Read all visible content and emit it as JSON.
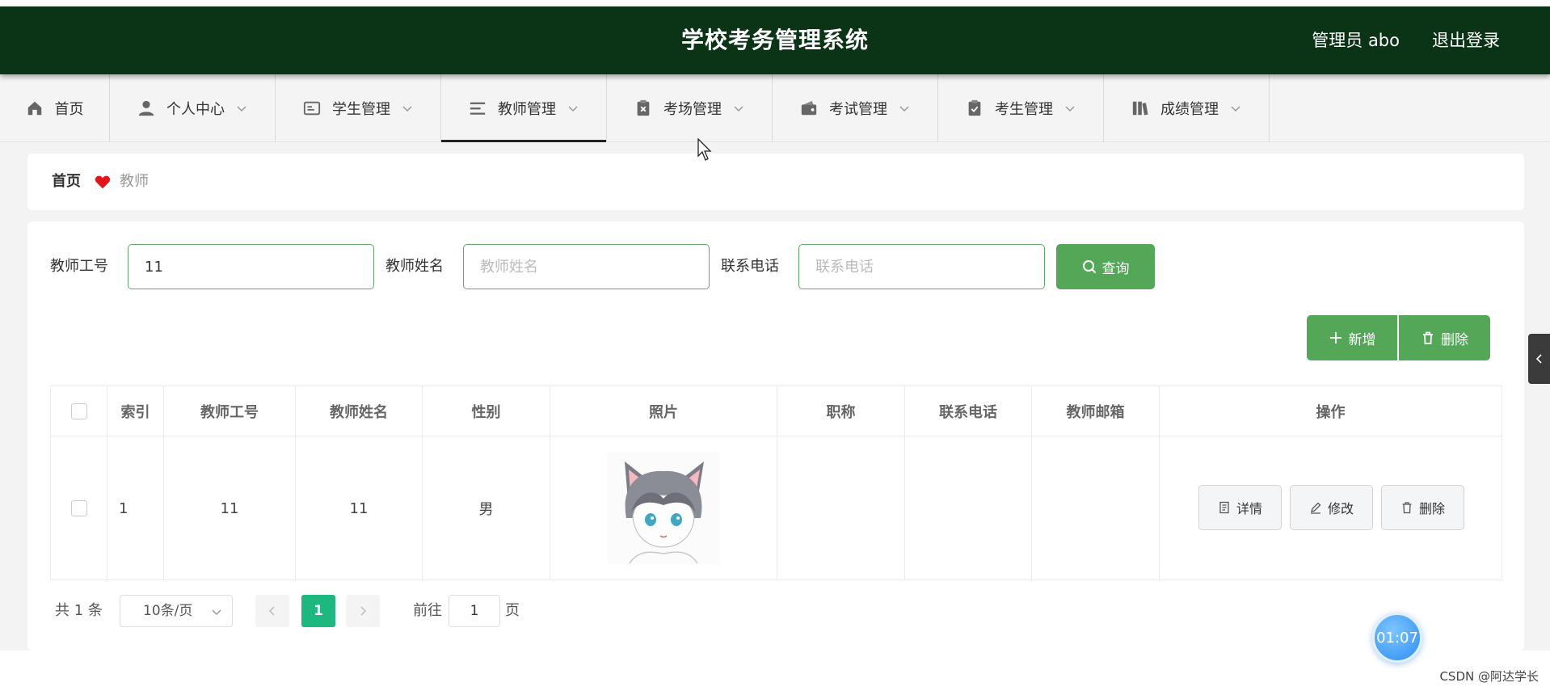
{
  "header": {
    "title": "学校考务管理系统",
    "user": "管理员 abo",
    "logout": "退出登录"
  },
  "nav": {
    "items": [
      {
        "label": "首页",
        "icon": "home-icon"
      },
      {
        "label": "个人中心",
        "icon": "user-icon"
      },
      {
        "label": "学生管理",
        "icon": "id-card-icon"
      },
      {
        "label": "教师管理",
        "icon": "list-icon"
      },
      {
        "label": "考场管理",
        "icon": "clipboard-x-icon"
      },
      {
        "label": "考试管理",
        "icon": "wallet-icon"
      },
      {
        "label": "考生管理",
        "icon": "clipboard-check-icon"
      },
      {
        "label": "成绩管理",
        "icon": "books-icon"
      }
    ],
    "active": "教师管理"
  },
  "breadcrumb": {
    "home": "首页",
    "current": "教师"
  },
  "search": {
    "teacher_id_label": "教师工号",
    "teacher_id_value": "11",
    "teacher_name_label": "教师姓名",
    "teacher_name_placeholder": "教师姓名",
    "phone_label": "联系电话",
    "phone_placeholder": "联系电话",
    "query_label": "查询"
  },
  "actions": {
    "add_label": "新增",
    "delete_label": "删除"
  },
  "table": {
    "columns": [
      "索引",
      "教师工号",
      "教师姓名",
      "性别",
      "照片",
      "职称",
      "联系电话",
      "教师邮箱",
      "操作"
    ],
    "rows": [
      {
        "index": "1",
        "teacher_id": "11",
        "teacher_name": "11",
        "gender": "男",
        "photo": "anime-cat-boy-avatar",
        "title": "",
        "phone": "",
        "email": "",
        "ops": [
          "详情",
          "修改",
          "删除"
        ]
      }
    ]
  },
  "pagination": {
    "total": "共 1 条",
    "page_size": "10条/页",
    "current_page": "1",
    "goto_label": "前往",
    "goto_value": "1",
    "page_suffix": "页"
  },
  "overlay": {
    "timer": "01:07",
    "watermark": "CSDN @阿达学长"
  },
  "colors": {
    "header_bg": "#0b3315",
    "accent_green": "#55a758",
    "pager_active": "#1db880"
  }
}
